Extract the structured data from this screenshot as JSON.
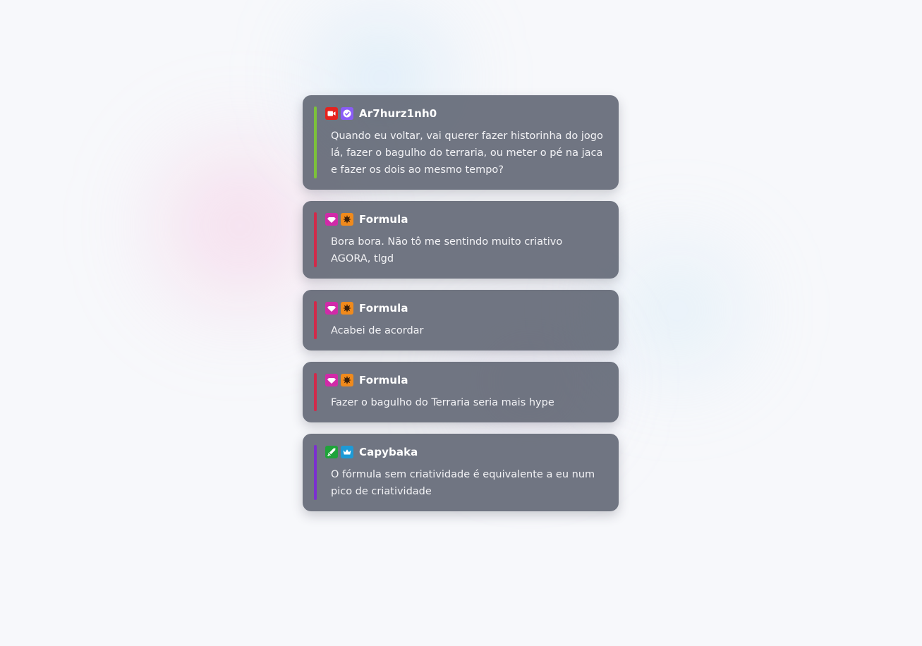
{
  "colors": {
    "accent_green": "#7cc23a",
    "accent_red": "#d12a4a",
    "accent_purple": "#7b2fd0",
    "badge_camera": "#e5231e",
    "badge_verified": "#8a5cf6",
    "badge_gem": "#d12aa8",
    "badge_burst": "#f08a1c",
    "badge_sword": "#1fa33a",
    "badge_crown": "#1e9ad6"
  },
  "messages": [
    {
      "username": "Ar7hurz1nh0",
      "text": "Quando eu voltar, vai querer fazer historinha do jogo lá, fazer o bagulho do terraria, ou meter o pé na jaca e fazer os dois ao mesmo tempo?",
      "accent": "#7cc23a",
      "badges": [
        "camera-icon",
        "verified-icon"
      ]
    },
    {
      "username": "Formula",
      "text": "Bora bora. Não tô me sentindo muito criativo AGORA, tlgd",
      "accent": "#d12a4a",
      "badges": [
        "gem-icon",
        "burst-icon"
      ]
    },
    {
      "username": "Formula",
      "text": "Acabei de acordar",
      "accent": "#d12a4a",
      "badges": [
        "gem-icon",
        "burst-icon"
      ]
    },
    {
      "username": "Formula",
      "text": "Fazer o bagulho do Terraria seria mais hype",
      "accent": "#d12a4a",
      "badges": [
        "gem-icon",
        "burst-icon"
      ]
    },
    {
      "username": "Capybaka",
      "text": "O fórmula sem criatividade é equivalente a eu num pico de criatividade",
      "accent": "#7b2fd0",
      "badges": [
        "sword-icon",
        "crown-icon"
      ]
    }
  ]
}
